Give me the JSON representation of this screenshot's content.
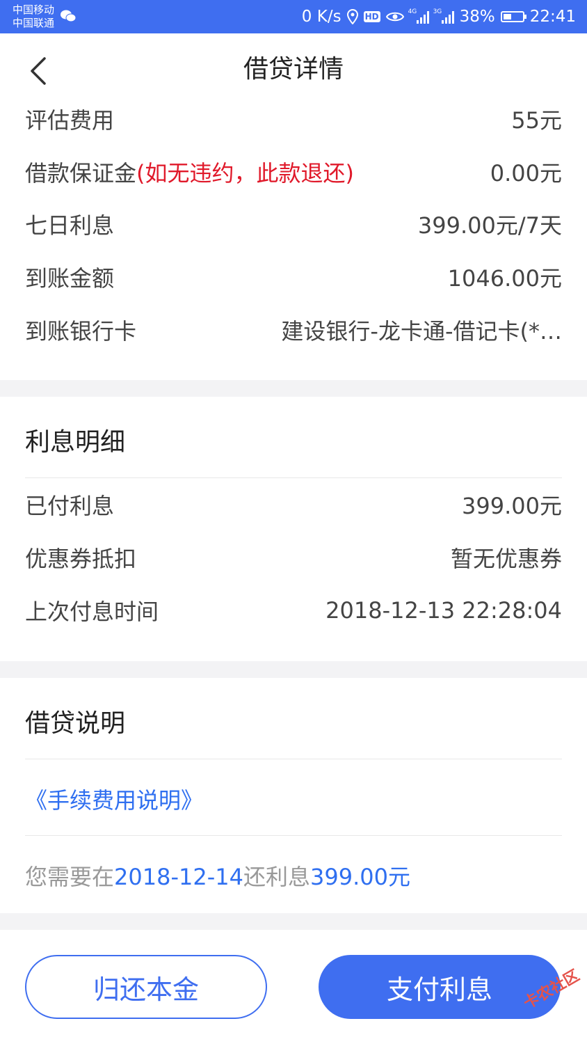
{
  "status_bar": {
    "carrier1": "中国移动",
    "carrier2": "中国联通",
    "net_speed": "0 K/s",
    "hd": "HD",
    "sig1_tag": "4G",
    "sig2_tag": "3G",
    "battery": "38%",
    "time": "22:41",
    "icons": [
      "wechat-icon",
      "location-icon",
      "hd-icon",
      "eye-icon",
      "signal-icon",
      "signal-icon",
      "battery-icon"
    ]
  },
  "header": {
    "title": "借贷详情"
  },
  "details": {
    "assess_fee": {
      "label": "评估费用",
      "value": "55元"
    },
    "deposit": {
      "label": "借款保证金",
      "note": "(如无违约，此款退还)",
      "value": "0.00元"
    },
    "seven_day_interest": {
      "label": "七日利息",
      "value": "399.00元/7天"
    },
    "amount_received": {
      "label": "到账金额",
      "value": "1046.00元"
    },
    "bank_card": {
      "label": "到账银行卡",
      "value": "建设银行-龙卡通-借记卡(*…"
    }
  },
  "interest": {
    "title": "利息明细",
    "paid": {
      "label": "已付利息",
      "value": "399.00元"
    },
    "coupon": {
      "label": "优惠券抵扣",
      "value": "暂无优惠券"
    },
    "last_time": {
      "label": "上次付息时间",
      "value": "2018-12-13 22:28:04"
    }
  },
  "explain": {
    "title": "借贷说明",
    "link": "《手续费用说明》",
    "notice_prefix": "您需要在",
    "notice_date": "2018-12-14",
    "notice_mid": "还利息",
    "notice_amount": "399.00元"
  },
  "actions": {
    "return_principal": "归还本金",
    "pay_interest": "支付利息"
  },
  "watermark": "卡农社区",
  "colors": {
    "accent": "#3f6ef0",
    "warning": "#e0192a",
    "link": "#2f6ff0"
  }
}
